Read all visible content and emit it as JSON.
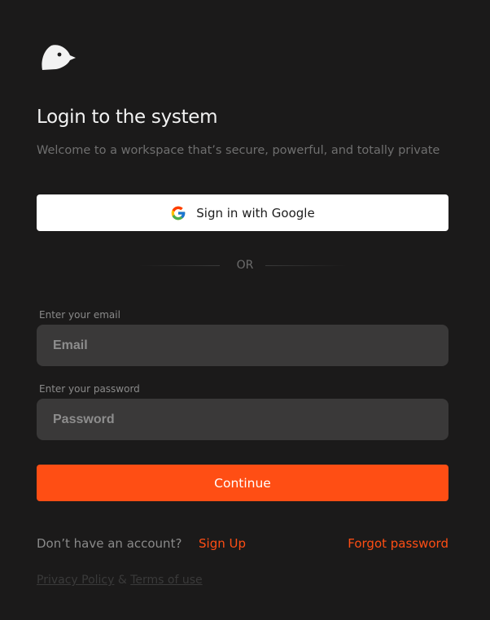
{
  "brand": {
    "logo_icon": "bird-logo-icon",
    "accent_color": "#ff4e14"
  },
  "header": {
    "title": "Login to the system",
    "subtitle": "Welcome to a workspace that’s secure, powerful, and totally private"
  },
  "google": {
    "label": "Sign in with Google",
    "icon": "google-icon"
  },
  "divider": {
    "label": "OR"
  },
  "email": {
    "label": "Enter your email",
    "placeholder": "Email",
    "value": ""
  },
  "password": {
    "label": "Enter your password",
    "placeholder": "Password",
    "value": ""
  },
  "continue": {
    "label": "Continue"
  },
  "footer": {
    "no_account": "Don’t have an account?",
    "signup": "Sign Up",
    "forgot": "Forgot password",
    "privacy": "Privacy Policy",
    "amp": "&",
    "terms": "Terms of use"
  }
}
